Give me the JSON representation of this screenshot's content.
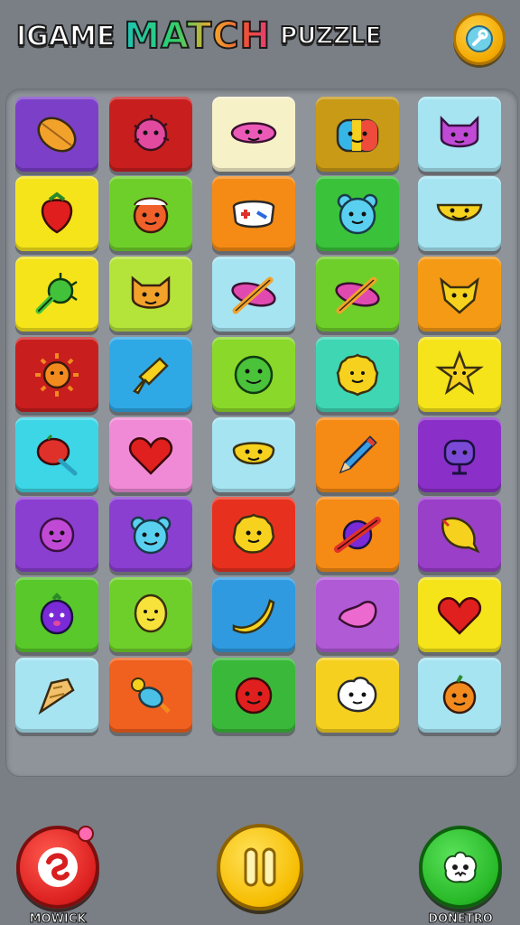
{
  "header": {
    "title_word1": "IGAME",
    "title_word2": "MATCH",
    "title_word3": "PUZZLE",
    "settings_icon": "wrench-icon"
  },
  "grid": {
    "rows": 8,
    "cols": 5,
    "tiles": [
      {
        "bg": "#7b3fc8",
        "icon": "leaf"
      },
      {
        "bg": "#c81e1e",
        "icon": "spiky-blob"
      },
      {
        "bg": "#f7f1c8",
        "icon": "pink-face"
      },
      {
        "bg": "#c99a16",
        "icon": "rainbow-bear"
      },
      {
        "bg": "#a6e4f2",
        "icon": "purple-cat"
      },
      {
        "bg": "#f5e41a",
        "icon": "strawberry"
      },
      {
        "bg": "#6fcf2a",
        "icon": "orange-monster"
      },
      {
        "bg": "#f58a14",
        "icon": "gamepad"
      },
      {
        "bg": "#39c23a",
        "icon": "blue-bear"
      },
      {
        "bg": "#a6e4f2",
        "icon": "yellow-smile"
      },
      {
        "bg": "#f5e41a",
        "icon": "green-bug"
      },
      {
        "bg": "#b4e33a",
        "icon": "orange-cat"
      },
      {
        "bg": "#a6e4f2",
        "icon": "pencil-cross"
      },
      {
        "bg": "#6fcf2a",
        "icon": "pencil-cross"
      },
      {
        "bg": "#f59a14",
        "icon": "yellow-fox"
      },
      {
        "bg": "#c81e1e",
        "icon": "sun"
      },
      {
        "bg": "#2fa8e6",
        "icon": "yellow-arrow"
      },
      {
        "bg": "#8ad82a",
        "icon": "green-smile"
      },
      {
        "bg": "#3fd6b4",
        "icon": "yellow-flower"
      },
      {
        "bg": "#f5e41a",
        "icon": "star"
      },
      {
        "bg": "#3cd6e6",
        "icon": "red-fruit"
      },
      {
        "bg": "#f08ad6",
        "icon": "heart"
      },
      {
        "bg": "#a6e4f2",
        "icon": "yellow-face"
      },
      {
        "bg": "#f58a14",
        "icon": "blue-pencil"
      },
      {
        "bg": "#8a2fc8",
        "icon": "purple-robot"
      },
      {
        "bg": "#8a3fd0",
        "icon": "purple-blob"
      },
      {
        "bg": "#8a3fd0",
        "icon": "blue-bear-2"
      },
      {
        "bg": "#e8301e",
        "icon": "yellow-sun-face"
      },
      {
        "bg": "#f58a14",
        "icon": "planet"
      },
      {
        "bg": "#9a3fc8",
        "icon": "lemon"
      },
      {
        "bg": "#58c82a",
        "icon": "eggplant"
      },
      {
        "bg": "#6fcf2a",
        "icon": "yellow-balloon"
      },
      {
        "bg": "#2f9ae0",
        "icon": "banana"
      },
      {
        "bg": "#b05ad6",
        "icon": "pink-heart"
      },
      {
        "bg": "#f5e41a",
        "icon": "red-heart"
      },
      {
        "bg": "#a6e4f2",
        "icon": "ice-cream"
      },
      {
        "bg": "#f0601e",
        "icon": "candy"
      },
      {
        "bg": "#3ab83a",
        "icon": "red-ball"
      },
      {
        "bg": "#f5d01e",
        "icon": "white-ghost"
      },
      {
        "bg": "#a6e4f2",
        "icon": "orange-fruit"
      }
    ]
  },
  "controls": {
    "left_label": "MOWICK",
    "left_icon": "swirl-icon",
    "mid_icon": "pause-icon",
    "right_label": "DONETRO",
    "right_icon": "monster-icon"
  }
}
